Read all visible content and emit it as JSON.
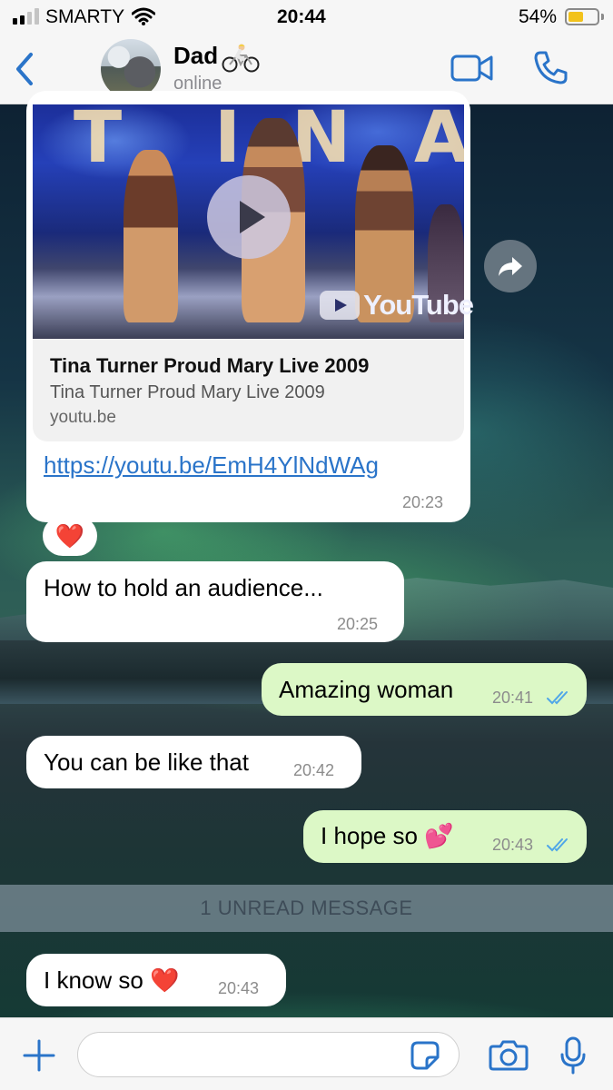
{
  "status_bar": {
    "carrier": "SMARTY",
    "time": "20:44",
    "battery_percent": "54%",
    "battery_level": 0.54,
    "signal_bars": 2
  },
  "header": {
    "back_icon": "chevron-left-icon",
    "contact_name": "Dad",
    "contact_emoji": "🚴🏻",
    "contact_status": "online",
    "video_icon": "video-camera-icon",
    "call_icon": "phone-icon"
  },
  "link_preview": {
    "thumbnail_text": "TINA",
    "youtube_label": "YouTube",
    "title": "Tina Turner Proud Mary Live 2009",
    "description": "Tina Turner Proud Mary Live 2009",
    "domain": "youtu.be",
    "url": "https://youtu.be/EmH4YlNdWAg",
    "time": "20:23",
    "reaction": "❤️"
  },
  "messages": [
    {
      "direction": "in",
      "text": "How to hold an audience...",
      "time": "20:25"
    },
    {
      "direction": "out",
      "text": "Amazing woman",
      "time": "20:41",
      "read": true
    },
    {
      "direction": "in",
      "text": "You can be like that",
      "time": "20:42"
    },
    {
      "direction": "out",
      "text": "I hope so 💕",
      "time": "20:43",
      "read": true
    },
    {
      "direction": "in",
      "text": "I know so ❤️",
      "time": "20:43"
    }
  ],
  "unread_banner": "1 UNREAD MESSAGE",
  "input_bar": {
    "placeholder": "",
    "icons": [
      "plus-icon",
      "sticker-icon",
      "camera-icon",
      "microphone-icon"
    ]
  },
  "colors": {
    "accent": "#2a74c9",
    "outgoing_bubble": "#dcf8c6",
    "incoming_bubble": "#ffffff",
    "read_ticks": "#4fa6e8",
    "battery": "#f2c21b"
  }
}
